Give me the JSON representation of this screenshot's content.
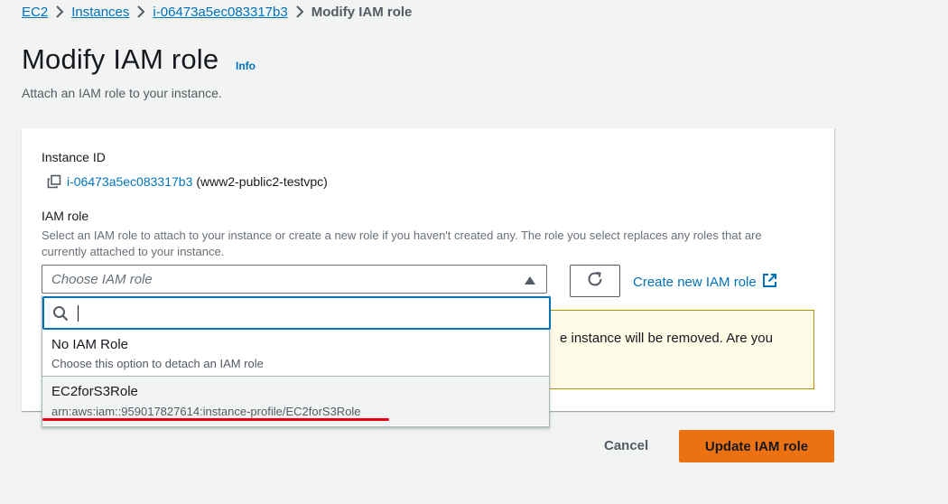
{
  "breadcrumb": {
    "items": [
      "EC2",
      "Instances",
      "i-06473a5ec083317b3"
    ],
    "current": "Modify IAM role"
  },
  "header": {
    "title": "Modify IAM role",
    "info": "Info",
    "subtitle": "Attach an IAM role to your instance."
  },
  "instance": {
    "label": "Instance ID",
    "id": "i-06473a5ec083317b3",
    "name": "(www2-public2-testvpc)"
  },
  "iam_role": {
    "label": "IAM role",
    "description": "Select an IAM role to attach to your instance or create a new role if you haven't created any. The role you select replaces any roles that are currently attached to your instance.",
    "placeholder": "Choose IAM role",
    "search_value": "",
    "create_link": "Create new IAM role"
  },
  "dropdown": {
    "options": [
      {
        "label": "No IAM Role",
        "sub": "Choose this option to detach an IAM role"
      },
      {
        "label": "EC2forS3Role",
        "sub": "arn:aws:iam::959017827614:instance-profile/EC2forS3Role"
      }
    ]
  },
  "warning": {
    "visible_text": "e instance will be removed. Are you"
  },
  "actions": {
    "cancel": "Cancel",
    "update": "Update IAM role"
  },
  "colors": {
    "link": "#0073bb",
    "primary_button": "#ec7211",
    "warning_bg": "#fffbe6",
    "annotation_underline": "#e60012"
  }
}
